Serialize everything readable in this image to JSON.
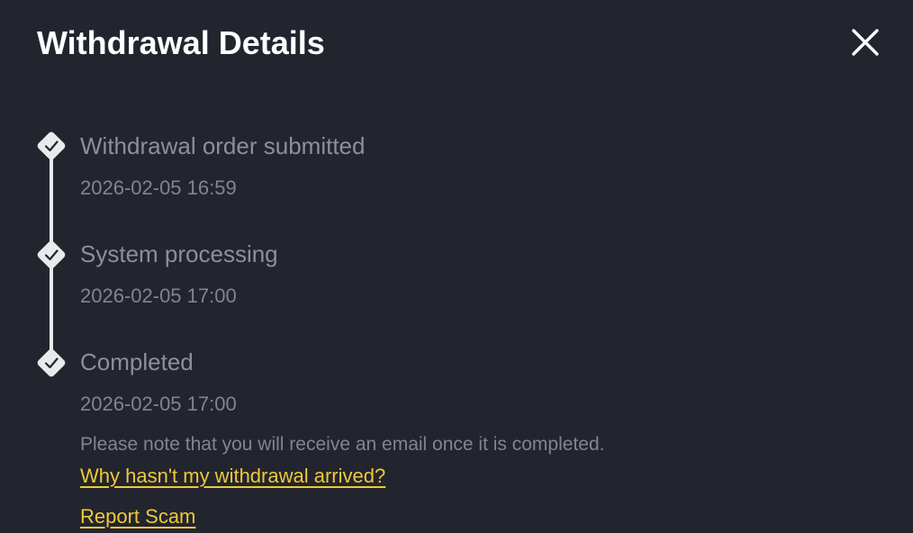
{
  "header": {
    "title": "Withdrawal Details",
    "close_icon": "close-icon"
  },
  "steps": [
    {
      "title": "Withdrawal order submitted",
      "time": "2026-02-05 16:59",
      "status": "done",
      "icon": "check-icon"
    },
    {
      "title": "System processing",
      "time": "2026-02-05 17:00",
      "status": "done",
      "icon": "check-icon"
    },
    {
      "title": "Completed",
      "time": "2026-02-05 17:00",
      "status": "done",
      "icon": "check-icon"
    }
  ],
  "note": "Please note that you will receive an email once it is completed.",
  "links": {
    "why_not_arrived": "Why hasn't my withdrawal arrived?",
    "report_scam": "Report Scam"
  },
  "colors": {
    "background": "#22252e",
    "title": "#ffffff",
    "muted_text": "#8a909c",
    "link": "#f0c83a",
    "timeline": "#e9eaec"
  }
}
